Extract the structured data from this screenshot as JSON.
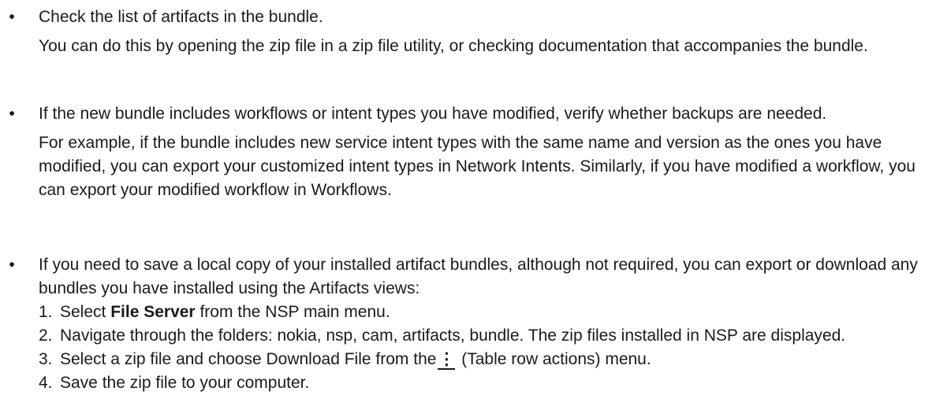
{
  "bullets": [
    {
      "lead": "Check the list of artifacts in the bundle.",
      "detail": "You can do this by opening the zip file in a zip file utility, or checking documentation that accompanies the bundle."
    },
    {
      "lead": "If the new bundle includes workflows or intent types you have modified, verify whether backups are needed.",
      "detail": "For example, if the bundle includes new service intent types with the same name and version as the ones you have modified, you can export your customized intent types in Network Intents. Similarly, if you have modified a workflow, you can export your modified workflow in Workflows."
    },
    {
      "lead": "If you need to save a local copy of your installed artifact bundles, although not required, you can export or download any bundles you have installed using the Artifacts views:",
      "steps": [
        {
          "num": "1.",
          "pre": "Select ",
          "bold": "File Server",
          "post": " from the NSP main menu."
        },
        {
          "num": "2.",
          "text": "Navigate through the folders: nokia, nsp, cam, artifacts, bundle. The zip files installed in NSP are displayed."
        },
        {
          "num": "3.",
          "pre": "Select a zip file and choose Download File from the",
          "icon": "⋮",
          "post": " (Table row actions) menu."
        },
        {
          "num": "4.",
          "text": "Save the zip file to your computer."
        }
      ]
    }
  ],
  "bullet_glyph": "•",
  "icons": {
    "row_actions": "kebab-vertical-icon"
  }
}
